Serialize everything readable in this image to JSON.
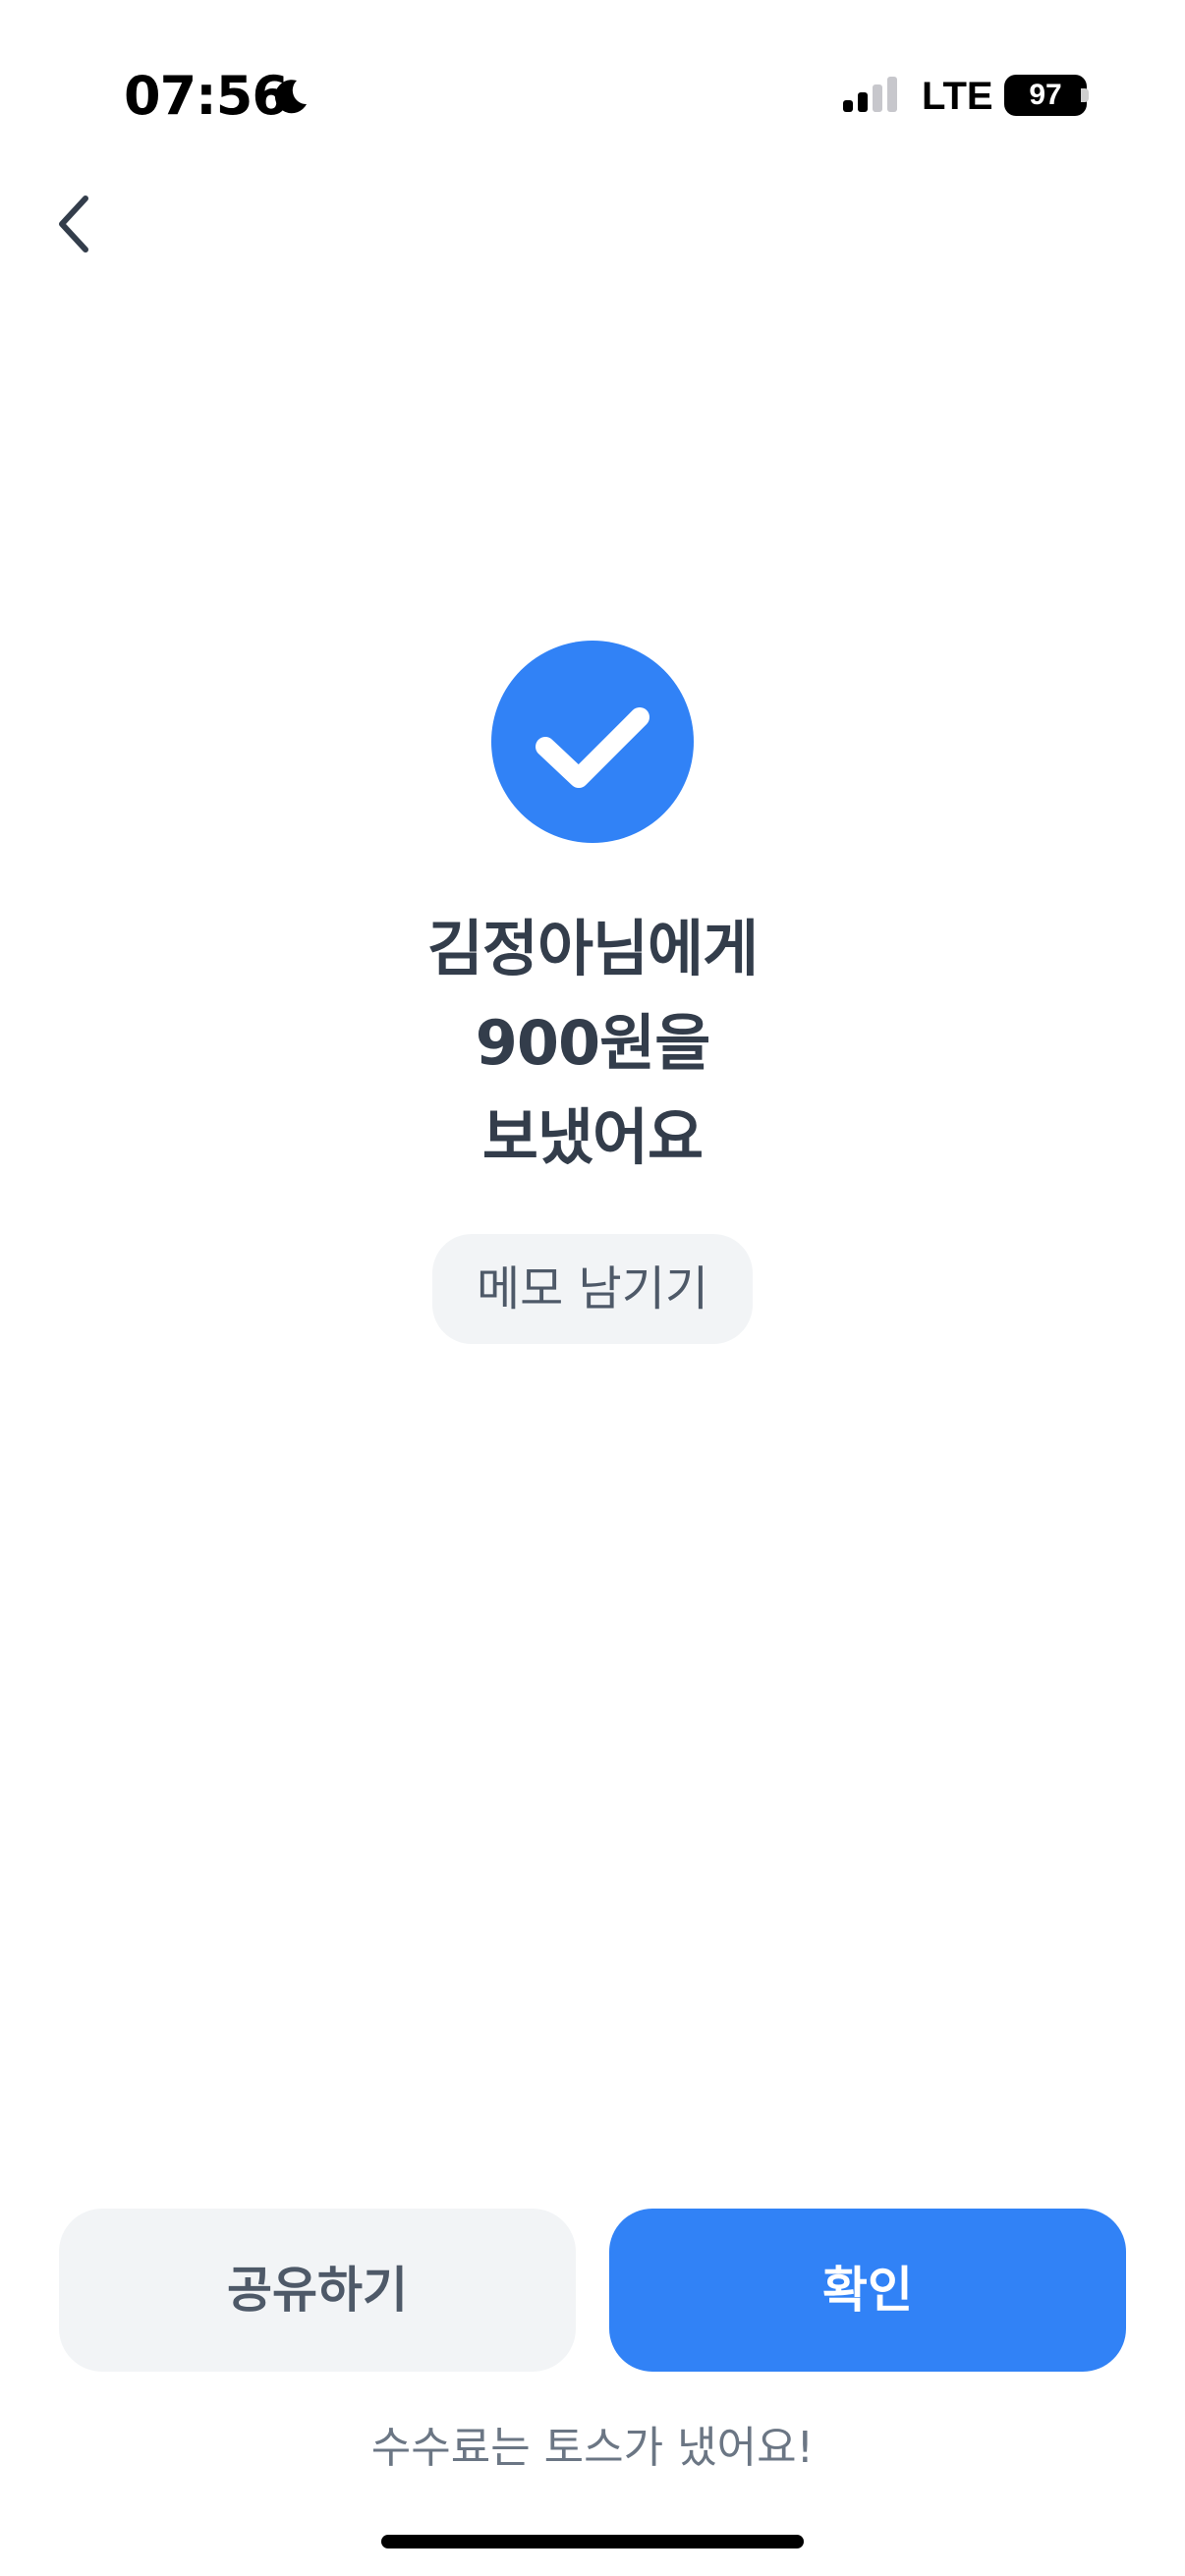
{
  "status_bar": {
    "time": "07:56",
    "focus_icon": "moon-icon",
    "signal_icon": "cellular-signal-icon",
    "network": "LTE",
    "battery": "97"
  },
  "nav": {
    "back_icon": "chevron-left-icon"
  },
  "result": {
    "icon": "check-circle-icon",
    "line1": "김정아님에게",
    "line2": "900원을",
    "line3": "보냈어요"
  },
  "memo": {
    "label": "메모 남기기"
  },
  "actions": {
    "share_label": "공유하기",
    "confirm_label": "확인"
  },
  "footer": {
    "fee_notice": "수수료는 토스가 냈어요!"
  },
  "colors": {
    "accent": "#3182f6",
    "text_primary": "#333d4b",
    "secondary_bg": "#f2f4f6",
    "secondary_text": "#4e5968",
    "muted_text": "#6b7684"
  }
}
